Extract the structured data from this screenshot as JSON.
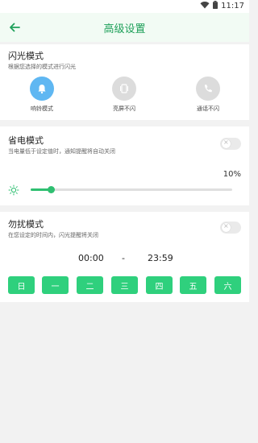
{
  "status": {
    "time": "11:17"
  },
  "header": {
    "title": "高级设置"
  },
  "flash": {
    "title": "闪光模式",
    "desc": "根据您选择的模式进行闪光",
    "modes": [
      {
        "label": "响铃模式",
        "icon": "bell-icon",
        "active": true
      },
      {
        "label": "亮屏不闪",
        "icon": "screen-icon",
        "active": false
      },
      {
        "label": "通话不闪",
        "icon": "phone-icon",
        "active": false
      }
    ]
  },
  "power": {
    "title": "省电模式",
    "desc": "当电量低于设定值时，通知提醒将自动关闭",
    "enabled": false,
    "level_percent": "10%",
    "level_fraction": 0.1
  },
  "dnd": {
    "title": "勿扰模式",
    "desc": "在您设定的时间内，闪光提醒将关闭",
    "enabled": false,
    "start": "00:00",
    "separator": "-",
    "end": "23:59",
    "days": [
      "日",
      "一",
      "二",
      "三",
      "四",
      "五",
      "六"
    ]
  },
  "colors": {
    "accent": "#2fd07d",
    "title": "#1fa05a",
    "active_mode": "#5fb7f2",
    "inactive_mode": "#dcdcdc"
  }
}
